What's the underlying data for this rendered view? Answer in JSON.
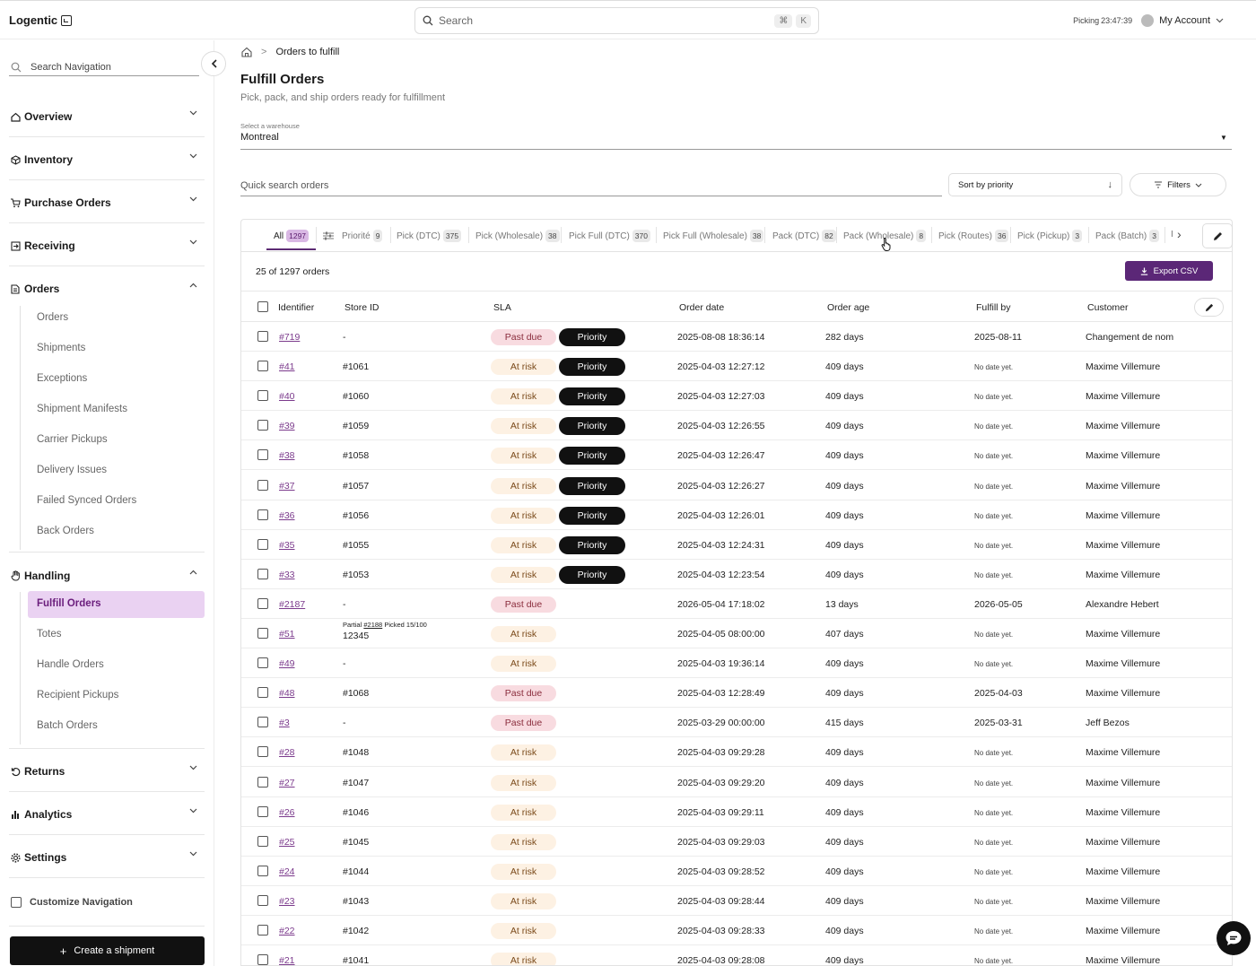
{
  "app": {
    "name": "Logentic"
  },
  "topbar": {
    "search_placeholder": "Search",
    "kbd_cmd": "⌘",
    "kbd_k": "K",
    "picking_label": "Picking",
    "picking_time": "23:47:39",
    "account_label": "My Account"
  },
  "sidebar": {
    "search_placeholder": "Search Navigation",
    "sections": {
      "overview": "Overview",
      "inventory": "Inventory",
      "purchase_orders": "Purchase Orders",
      "receiving": "Receiving",
      "orders": "Orders",
      "handling": "Handling",
      "returns": "Returns",
      "analytics": "Analytics",
      "settings": "Settings"
    },
    "orders_items": [
      "Orders",
      "Shipments",
      "Exceptions",
      "Shipment Manifests",
      "Carrier Pickups",
      "Delivery Issues",
      "Failed Synced Orders",
      "Back Orders"
    ],
    "handling_items": [
      "Fulfill Orders",
      "Totes",
      "Handle Orders",
      "Recipient Pickups",
      "Batch Orders"
    ],
    "customize_label": "Customize Navigation",
    "create_label": "Create a shipment"
  },
  "page": {
    "breadcrumb": "Orders to fulfill",
    "title": "Fulfill Orders",
    "subtitle": "Pick, pack, and ship orders ready for fulfillment",
    "warehouse_label": "Select a warehouse",
    "warehouse_value": "Montreal",
    "quick_search_placeholder": "Quick search orders",
    "sort_label": "Sort by priority",
    "filters_label": "Filters"
  },
  "tabs": [
    {
      "label": "All",
      "count": "1297"
    },
    {
      "label": "Priorité",
      "count": "9"
    },
    {
      "label": "Pick (DTC)",
      "count": "375"
    },
    {
      "label": "Pick (Wholesale)",
      "count": "38"
    },
    {
      "label": "Pick Full (DTC)",
      "count": "370"
    },
    {
      "label": "Pick Full (Wholesale)",
      "count": "38"
    },
    {
      "label": "Pack (DTC)",
      "count": "82"
    },
    {
      "label": "Pack (Wholesale)",
      "count": "8"
    },
    {
      "label": "Pick (Routes)",
      "count": "36"
    },
    {
      "label": "Pick (Pickup)",
      "count": "3"
    },
    {
      "label": "Pack (Batch)",
      "count": "3"
    },
    {
      "label": "I",
      "count": ""
    }
  ],
  "table": {
    "count_text": "25 of 1297 orders",
    "export_label": "Export CSV",
    "columns": [
      "Identifier",
      "Store ID",
      "SLA",
      "Order date",
      "Order age",
      "Fulfill by",
      "Customer"
    ],
    "priority_label": "Priority",
    "partial": {
      "prefix": "Partial",
      "link": "#2188",
      "suffix": "Picked 15/100"
    },
    "rows": [
      {
        "id": "#719",
        "store": "-",
        "sla": "Past due",
        "priority": true,
        "date": "2025-08-08 18:36:14",
        "age": "282 days",
        "fulfill": "2025-08-11",
        "customer": "Changement de nom"
      },
      {
        "id": "#41",
        "store": "#1061",
        "sla": "At risk",
        "priority": true,
        "date": "2025-04-03 12:27:12",
        "age": "409 days",
        "fulfill": "No date yet.",
        "customer": "Maxime Villemure"
      },
      {
        "id": "#40",
        "store": "#1060",
        "sla": "At risk",
        "priority": true,
        "date": "2025-04-03 12:27:03",
        "age": "409 days",
        "fulfill": "No date yet.",
        "customer": "Maxime Villemure"
      },
      {
        "id": "#39",
        "store": "#1059",
        "sla": "At risk",
        "priority": true,
        "date": "2025-04-03 12:26:55",
        "age": "409 days",
        "fulfill": "No date yet.",
        "customer": "Maxime Villemure"
      },
      {
        "id": "#38",
        "store": "#1058",
        "sla": "At risk",
        "priority": true,
        "date": "2025-04-03 12:26:47",
        "age": "409 days",
        "fulfill": "No date yet.",
        "customer": "Maxime Villemure"
      },
      {
        "id": "#37",
        "store": "#1057",
        "sla": "At risk",
        "priority": true,
        "date": "2025-04-03 12:26:27",
        "age": "409 days",
        "fulfill": "No date yet.",
        "customer": "Maxime Villemure"
      },
      {
        "id": "#36",
        "store": "#1056",
        "sla": "At risk",
        "priority": true,
        "date": "2025-04-03 12:26:01",
        "age": "409 days",
        "fulfill": "No date yet.",
        "customer": "Maxime Villemure"
      },
      {
        "id": "#35",
        "store": "#1055",
        "sla": "At risk",
        "priority": true,
        "date": "2025-04-03 12:24:31",
        "age": "409 days",
        "fulfill": "No date yet.",
        "customer": "Maxime Villemure"
      },
      {
        "id": "#33",
        "store": "#1053",
        "sla": "At risk",
        "priority": true,
        "date": "2025-04-03 12:23:54",
        "age": "409 days",
        "fulfill": "No date yet.",
        "customer": "Maxime Villemure"
      },
      {
        "id": "#2187",
        "store": "-",
        "sla": "Past due",
        "priority": false,
        "date": "2026-05-04 17:18:02",
        "age": "13 days",
        "fulfill": "2026-05-05",
        "customer": "Alexandre Hebert"
      },
      {
        "id": "#51",
        "store": "12345",
        "sla": "At risk",
        "priority": false,
        "partial": true,
        "date": "2025-04-05 08:00:00",
        "age": "407 days",
        "fulfill": "No date yet.",
        "customer": "Maxime Villemure"
      },
      {
        "id": "#49",
        "store": "-",
        "sla": "At risk",
        "priority": false,
        "date": "2025-04-03 19:36:14",
        "age": "409 days",
        "fulfill": "No date yet.",
        "customer": "Maxime Villemure"
      },
      {
        "id": "#48",
        "store": "#1068",
        "sla": "Past due",
        "priority": false,
        "date": "2025-04-03 12:28:49",
        "age": "409 days",
        "fulfill": "2025-04-03",
        "customer": "Maxime Villemure"
      },
      {
        "id": "#3",
        "store": "-",
        "sla": "Past due",
        "priority": false,
        "date": "2025-03-29 00:00:00",
        "age": "415 days",
        "fulfill": "2025-03-31",
        "customer": "Jeff Bezos"
      },
      {
        "id": "#28",
        "store": "#1048",
        "sla": "At risk",
        "priority": false,
        "date": "2025-04-03 09:29:28",
        "age": "409 days",
        "fulfill": "No date yet.",
        "customer": "Maxime Villemure"
      },
      {
        "id": "#27",
        "store": "#1047",
        "sla": "At risk",
        "priority": false,
        "date": "2025-04-03 09:29:20",
        "age": "409 days",
        "fulfill": "No date yet.",
        "customer": "Maxime Villemure"
      },
      {
        "id": "#26",
        "store": "#1046",
        "sla": "At risk",
        "priority": false,
        "date": "2025-04-03 09:29:11",
        "age": "409 days",
        "fulfill": "No date yet.",
        "customer": "Maxime Villemure"
      },
      {
        "id": "#25",
        "store": "#1045",
        "sla": "At risk",
        "priority": false,
        "date": "2025-04-03 09:29:03",
        "age": "409 days",
        "fulfill": "No date yet.",
        "customer": "Maxime Villemure"
      },
      {
        "id": "#24",
        "store": "#1044",
        "sla": "At risk",
        "priority": false,
        "date": "2025-04-03 09:28:52",
        "age": "409 days",
        "fulfill": "No date yet.",
        "customer": "Maxime Villemure"
      },
      {
        "id": "#23",
        "store": "#1043",
        "sla": "At risk",
        "priority": false,
        "date": "2025-04-03 09:28:44",
        "age": "409 days",
        "fulfill": "No date yet.",
        "customer": "Maxime Villemure"
      },
      {
        "id": "#22",
        "store": "#1042",
        "sla": "At risk",
        "priority": false,
        "date": "2025-04-03 09:28:33",
        "age": "409 days",
        "fulfill": "No date yet.",
        "customer": "Maxime Villemure"
      },
      {
        "id": "#21",
        "store": "#1041",
        "sla": "At risk",
        "priority": false,
        "date": "2025-04-03 09:28:08",
        "age": "409 days",
        "fulfill": "No date yet.",
        "customer": "Maxime Villemure"
      }
    ]
  },
  "colors": {
    "accent": "#5b2777",
    "active_nav_bg": "#ead2f2",
    "past_due_bg": "#f8dbe0",
    "at_risk_bg": "#fdf1e3"
  }
}
